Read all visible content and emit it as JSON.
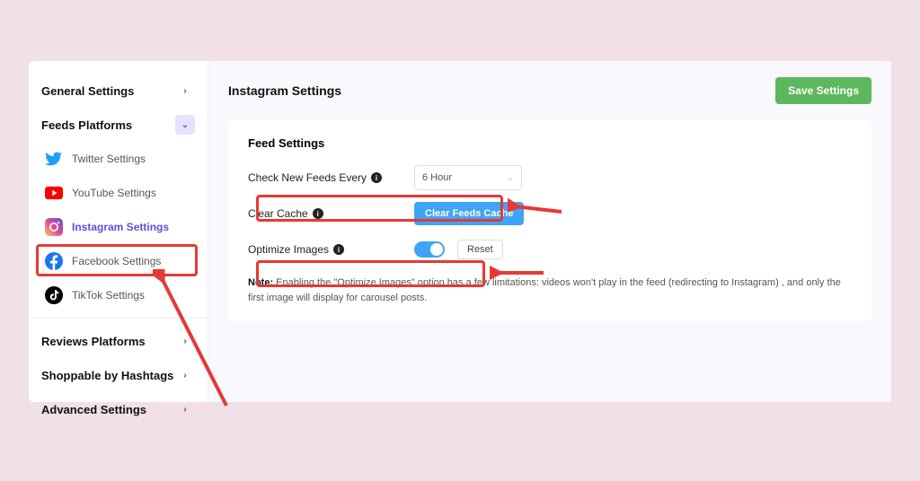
{
  "sidebar": {
    "general": "General Settings",
    "feeds_platforms": "Feeds Platforms",
    "items": [
      {
        "label": "Twitter Settings"
      },
      {
        "label": "YouTube Settings"
      },
      {
        "label": "Instagram Settings"
      },
      {
        "label": "Facebook Settings"
      },
      {
        "label": "TikTok Settings"
      }
    ],
    "reviews": "Reviews Platforms",
    "shoppable": "Shoppable by Hashtags",
    "advanced": "Advanced Settings"
  },
  "main": {
    "title": "Instagram Settings",
    "save": "Save Settings",
    "card_title": "Feed Settings",
    "check_label": "Check New Feeds Every",
    "check_value": "6 Hour",
    "cache_label": "Clear Cache",
    "cache_button": "Clear Feeds Cache",
    "optimize_label": "Optimize Images",
    "reset": "Reset",
    "note_prefix": "Note:",
    "note_text": " Enabling the \"Optimize Images\" option has a few limitations: videos won't play in the feed (redirecting to Instagram) , and only the first image will display for carousel posts."
  }
}
